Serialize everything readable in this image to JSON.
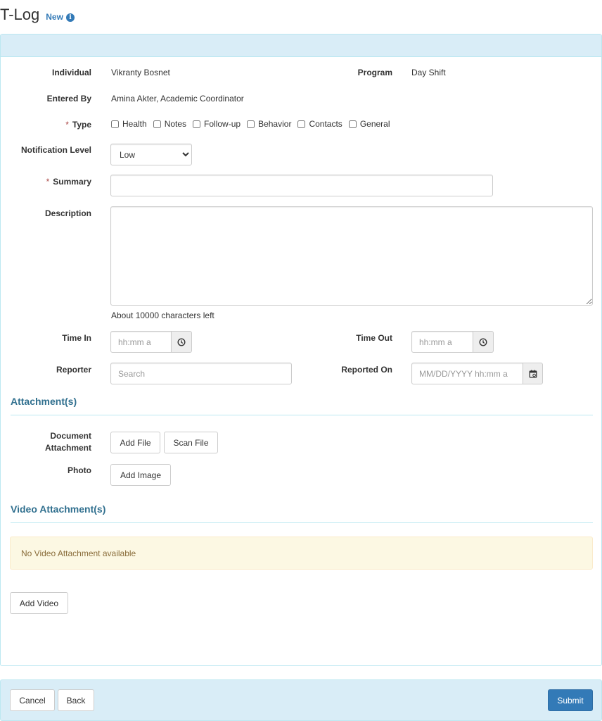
{
  "header": {
    "title": "T-Log",
    "badge": "New",
    "info_icon": "info-circle-icon"
  },
  "form": {
    "individual": {
      "label": "Individual",
      "value": "Vikranty Bosnet"
    },
    "program": {
      "label": "Program",
      "value": "Day Shift"
    },
    "entered_by": {
      "label": "Entered By",
      "value": "Amina Akter, Academic Coordinator"
    },
    "type": {
      "required_mark": "*",
      "label": "Type",
      "options": [
        "Health",
        "Notes",
        "Follow-up",
        "Behavior",
        "Contacts",
        "General"
      ]
    },
    "notification_level": {
      "label": "Notification Level",
      "selected": "Low"
    },
    "summary": {
      "required_mark": "*",
      "label": "Summary",
      "value": ""
    },
    "description": {
      "label": "Description",
      "value": "",
      "chars_left": "About 10000 characters left"
    },
    "time_in": {
      "label": "Time In",
      "placeholder": "hh:mm a",
      "icon": "clock-icon"
    },
    "time_out": {
      "label": "Time Out",
      "placeholder": "hh:mm a",
      "icon": "clock-icon"
    },
    "reporter": {
      "label": "Reporter",
      "placeholder": "Search"
    },
    "reported_on": {
      "label": "Reported On",
      "placeholder": "MM/DD/YYYY hh:mm a",
      "icon": "calendar-icon"
    }
  },
  "attachments": {
    "title": "Attachment(s)",
    "document_label_line1": "Document",
    "document_label_line2": "Attachment",
    "add_file": "Add File",
    "scan_file": "Scan File",
    "photo_label": "Photo",
    "add_image": "Add Image"
  },
  "video": {
    "title": "Video Attachment(s)",
    "empty_message": "No Video Attachment available",
    "add_video": "Add Video"
  },
  "footer": {
    "cancel": "Cancel",
    "back": "Back",
    "submit": "Submit"
  },
  "colors": {
    "panel_heading": "#d9edf7",
    "primary": "#337ab7",
    "section_title": "#31708f",
    "warning_bg": "#fcf8e3",
    "required": "#a94442"
  }
}
